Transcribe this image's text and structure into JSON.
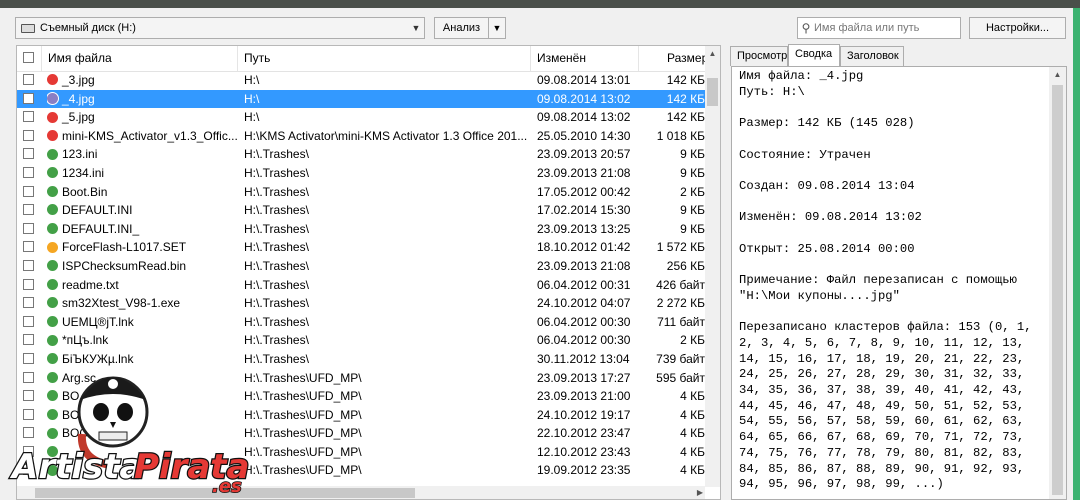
{
  "toolbar": {
    "drive": "Съемный диск (H:)",
    "analyze_label": "Анализ",
    "search_placeholder": "Имя файла или путь",
    "settings_label": "Настройки..."
  },
  "columns": [
    "Имя файла",
    "Путь",
    "Изменён",
    "Размер"
  ],
  "files": [
    {
      "name": "_3.jpg",
      "path": "H:\\",
      "modified": "09.08.2014 13:01",
      "size": "142 КБ",
      "status": "red"
    },
    {
      "name": "_4.jpg",
      "path": "H:\\",
      "modified": "09.08.2014 13:02",
      "size": "142 КБ",
      "status": "purple",
      "selected": true
    },
    {
      "name": "_5.jpg",
      "path": "H:\\",
      "modified": "09.08.2014 13:02",
      "size": "142 КБ",
      "status": "red"
    },
    {
      "name": "mini-KMS_Activator_v1.3_Offic...",
      "path": "H:\\KMS Activator\\mini-KMS Activator 1.3 Office 201...",
      "modified": "25.05.2010 14:30",
      "size": "1 018 КБ",
      "status": "red"
    },
    {
      "name": "123.ini",
      "path": "H:\\.Trashes\\",
      "modified": "23.09.2013 20:57",
      "size": "9 КБ",
      "status": "green"
    },
    {
      "name": "1234.ini",
      "path": "H:\\.Trashes\\",
      "modified": "23.09.2013 21:08",
      "size": "9 КБ",
      "status": "green"
    },
    {
      "name": "Boot.Bin",
      "path": "H:\\.Trashes\\",
      "modified": "17.05.2012 00:42",
      "size": "2 КБ",
      "status": "green"
    },
    {
      "name": "DEFAULT.INI",
      "path": "H:\\.Trashes\\",
      "modified": "17.02.2014 15:30",
      "size": "9 КБ",
      "status": "green"
    },
    {
      "name": "DEFAULT.INI_",
      "path": "H:\\.Trashes\\",
      "modified": "23.09.2013 13:25",
      "size": "9 КБ",
      "status": "green"
    },
    {
      "name": "ForceFlash-L1017.SET",
      "path": "H:\\.Trashes\\",
      "modified": "18.10.2012 01:42",
      "size": "1 572 КБ",
      "status": "orange"
    },
    {
      "name": "ISPChecksumRead.bin",
      "path": "H:\\.Trashes\\",
      "modified": "23.09.2013 21:08",
      "size": "256 КБ",
      "status": "green"
    },
    {
      "name": "readme.txt",
      "path": "H:\\.Trashes\\",
      "modified": "06.04.2012 00:31",
      "size": "426 байт",
      "status": "green"
    },
    {
      "name": "sm32Xtest_V98-1.exe",
      "path": "H:\\.Trashes\\",
      "modified": "24.10.2012 04:07",
      "size": "2 272 КБ",
      "status": "green"
    },
    {
      "name": "UEMЦ®jT.lnk",
      "path": "H:\\.Trashes\\",
      "modified": "06.04.2012 00:30",
      "size": "711 байт",
      "status": "green"
    },
    {
      "name": "*пЦъ.lnk",
      "path": "H:\\.Trashes\\",
      "modified": "06.04.2012 00:30",
      "size": "2 КБ",
      "status": "green"
    },
    {
      "name": "БіЪКУЖµ.lnk",
      "path": "H:\\.Trashes\\",
      "modified": "30.11.2012 13:04",
      "size": "739 байт",
      "status": "green"
    },
    {
      "name": "Arg.sc",
      "path": "H:\\.Trashes\\UFD_MP\\",
      "modified": "23.09.2013 17:27",
      "size": "595 байт",
      "status": "green"
    },
    {
      "name": "BO",
      "path": "H:\\.Trashes\\UFD_MP\\",
      "modified": "23.09.2013 21:00",
      "size": "4 КБ",
      "status": "green"
    },
    {
      "name": "BO",
      "path": "H:\\.Trashes\\UFD_MP\\",
      "modified": "24.10.2012 19:17",
      "size": "4 КБ",
      "status": "green"
    },
    {
      "name": "BOO",
      "path": "H:\\.Trashes\\UFD_MP\\",
      "modified": "22.10.2012 23:47",
      "size": "4 КБ",
      "status": "green"
    },
    {
      "name": "",
      "path": "H:\\.Trashes\\UFD_MP\\",
      "modified": "12.10.2012 23:43",
      "size": "4 КБ",
      "status": "green"
    },
    {
      "name": "",
      "path": "H:\\.Trashes\\UFD_MP\\",
      "modified": "19.09.2012 23:35",
      "size": "4 КБ",
      "status": "green"
    }
  ],
  "tabs": [
    "Просмотр",
    "Сводка",
    "Заголовок"
  ],
  "summary": "Имя файла: _4.jpg\nПуть: H:\\\n\nРазмер: 142 КБ (145 028)\n\nСостояние: Утрачен\n\nСоздан: 09.08.2014 13:04\n\nИзменён: 09.08.2014 13:02\n\nОткрыт: 25.08.2014 00:00\n\nПримечание: Файл перезаписан с помощью \"H:\\Мои купоны....jpg\"\n\nПерезаписано кластеров файла: 153 (0, 1, 2, 3, 4, 5, 6, 7, 8, 9, 10, 11, 12, 13, 14, 15, 16, 17, 18, 19, 20, 21, 22, 23, 24, 25, 26, 27, 28, 29, 30, 31, 32, 33, 34, 35, 36, 37, 38, 39, 40, 41, 42, 43, 44, 45, 46, 47, 48, 49, 50, 51, 52, 53, 54, 55, 56, 57, 58, 59, 60, 61, 62, 63, 64, 65, 66, 67, 68, 69, 70, 71, 72, 73, 74, 75, 76, 77, 78, 79, 80, 81, 82, 83, 84, 85, 86, 87, 88, 89, 90, 91, 92, 93, 94, 95, 96, 97, 98, 99, ...)",
  "watermark": {
    "text1": "Artista",
    "text2": "Pirata",
    "text3": ".es"
  },
  "colors": {
    "selection": "#3399ff",
    "red": "#e53935",
    "green": "#43a047",
    "orange": "#f5a623",
    "purple": "#8a7fc4"
  }
}
